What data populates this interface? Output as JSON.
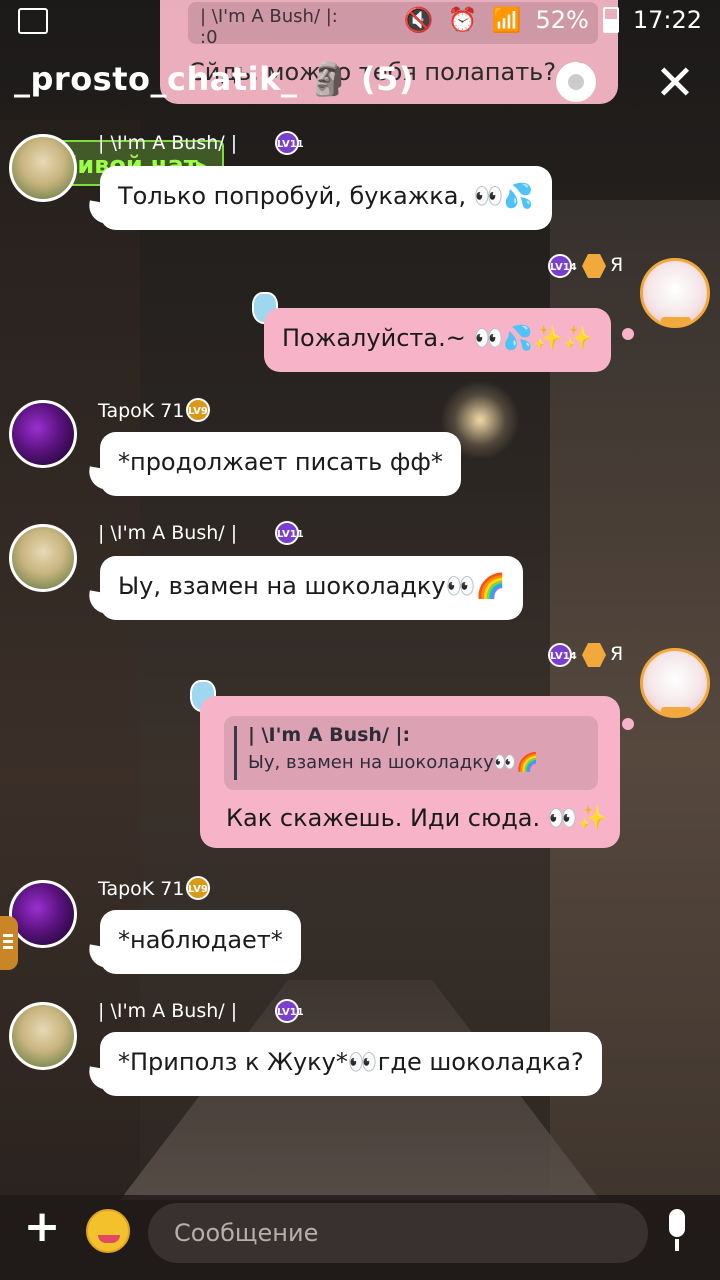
{
  "status_bar": {
    "battery": "52%",
    "time": "17:22"
  },
  "pinned_preview": {
    "quote_top": "|     \\I'm A Bush/  |:",
    "quote_text": ":0",
    "text": "Сйдь, можно тебя полапать? :0"
  },
  "header": {
    "title": "_prosto_chatik_ 🗿 (5)"
  },
  "live_chat": {
    "label": "Живой чат"
  },
  "messages": [
    {
      "user": "|     \\I'm A Bush/     |",
      "level": "LV11",
      "text": "Только попробуй, букажка, 👀💦"
    },
    {
      "user": "Я",
      "level": "LV14",
      "text": "Пожалуйста.~ 👀💦✨✨"
    },
    {
      "user": "TapoK 71",
      "level": "LV9",
      "text": "*продолжает писать фф*"
    },
    {
      "user": "|     \\I'm A Bush/     |",
      "level": "LV11",
      "text": "Ыу, взамен на шоколадку👀🌈"
    },
    {
      "user": "Я",
      "level": "LV14",
      "quote_author": "|     \\I'm A Bush/     |:",
      "quote_text": "Ыу, взамен на шоколадку👀🌈",
      "text": "Как скажешь. Иди сюда. 👀✨"
    },
    {
      "user": "TapoK 71",
      "level": "LV9",
      "text": "*наблюдает*"
    },
    {
      "user": "|     \\I'm A Bush/     |",
      "level": "LV11",
      "text": "*Приполз к Жуку*👀где шоколадка?"
    }
  ],
  "input": {
    "placeholder": "Сообщение"
  },
  "colors": {
    "accent_pink": "#f7b4c8",
    "live_green": "#7edc3e",
    "gold": "#f2a93b"
  }
}
